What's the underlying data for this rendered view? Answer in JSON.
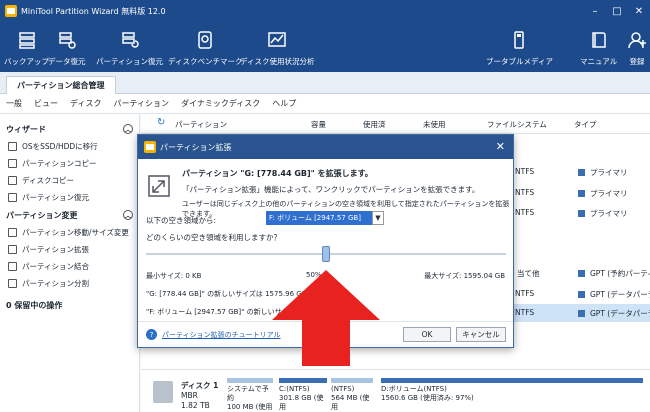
{
  "window": {
    "title": "MiniTool Partition Wizard 無料版 12.0",
    "controls": [
      "–",
      "□",
      "✕"
    ]
  },
  "toolbar": {
    "items": [
      {
        "label": "バックアップ",
        "icon": "backup-icon"
      },
      {
        "label": "データ復元",
        "icon": "data-recovery-icon"
      },
      {
        "label": "パーティション復元",
        "icon": "partition-recovery-icon"
      },
      {
        "label": "ディスクベンチマーク",
        "icon": "disk-benchmark-icon"
      },
      {
        "label": "ディスク使用状況分析",
        "icon": "space-analyzer-icon"
      },
      {
        "label": "ブータブルメディア",
        "icon": "bootable-media-icon"
      },
      {
        "label": "マニュアル",
        "icon": "manual-icon"
      },
      {
        "label": "登録",
        "icon": "register-icon"
      }
    ]
  },
  "tab": {
    "label": "パーティション総合管理"
  },
  "menu": [
    "一般",
    "ビュー",
    "ディスク",
    "パーティション",
    "ダイナミックディスク",
    "ヘルプ"
  ],
  "sidebar": {
    "wizard_title": "ウィザード",
    "wizard_items": [
      "OSをSSD/HDDに移行",
      "パーティションコピー",
      "ディスクコピー",
      "パーティション復元"
    ],
    "change_title": "パーティション変更",
    "change_items": [
      "パーティション移動/サイズ変更",
      "パーティション拡張",
      "パーティション結合",
      "パーティション分割"
    ],
    "pending": "0 保留中の操作"
  },
  "table": {
    "headers": [
      "パーティション",
      "容量",
      "使用済",
      "未使用",
      "ファイルシステム",
      "タイプ"
    ],
    "rows": [
      {
        "fs": "NTFS",
        "type": "プライマリ",
        "selected": false
      },
      {
        "fs": "NTFS",
        "type": "プライマリ",
        "selected": false
      },
      {
        "fs": "NTFS",
        "type": "プライマリ",
        "selected": false
      },
      {
        "fs": "",
        "type": "",
        "selected": false
      },
      {
        "fs": "当て他",
        "type": "GPT (予約パーティション)",
        "selected": false
      },
      {
        "fs": "NTFS",
        "type": "GPT (データパーティ",
        "selected": false
      },
      {
        "fs": "NTFS",
        "type": "GPT (データパーティ",
        "selected": true
      }
    ]
  },
  "diskmap": {
    "disk_name": "ディスク 1",
    "disk_style": "MBR",
    "disk_size": "1.82 TB",
    "partitions": [
      {
        "name": "システムで予約",
        "detail": "100 MB (使用"
      },
      {
        "name": "C:(NTFS)",
        "detail": "301.8 GB (使用"
      },
      {
        "name": "(NTFS)",
        "detail": "564 MB (使用"
      },
      {
        "name": "D:ボリューム(NTFS)",
        "detail": "1560.6 GB (使用済み: 97%)"
      }
    ]
  },
  "dialog": {
    "title": "パーティション拡張",
    "heading": "パーティション \"G: [778.44 GB]\" を拡張します。",
    "desc1": "「パーティション拡張」機能によって、ワンクリックでパーティションを拡張できます。",
    "desc2": "ユーザーは同じディスク上の他のパーティションの空き領域を利用して指定されたパーティションを拡張できます。",
    "from_label": "以下の空き領域から:",
    "from_value": "F: ボリューム [2947.57 GB]",
    "how_much": "どのくらいの空き領域を利用しますか？",
    "slider_fraction": 0.5,
    "min_size": "最小サイズ: 0 KB",
    "mid_pct": "50%",
    "max_size": "最大サイズ: 1595.04 GB",
    "new_g": "\"G: [778.44 GB]\" の新しいサイズは 1575.96 GB",
    "new_f": "\"F: ボリューム [2947.57 GB]\" の新しいサ",
    "help_link": "パーティション拡張のチュートリアル",
    "ok": "OK",
    "cancel": "キャンセル"
  },
  "colors": {
    "titlebar": "#1d4a8a",
    "accent": "#2f6fcf",
    "arrow": "#e8231f",
    "selected_row": "#cfe3f7"
  }
}
